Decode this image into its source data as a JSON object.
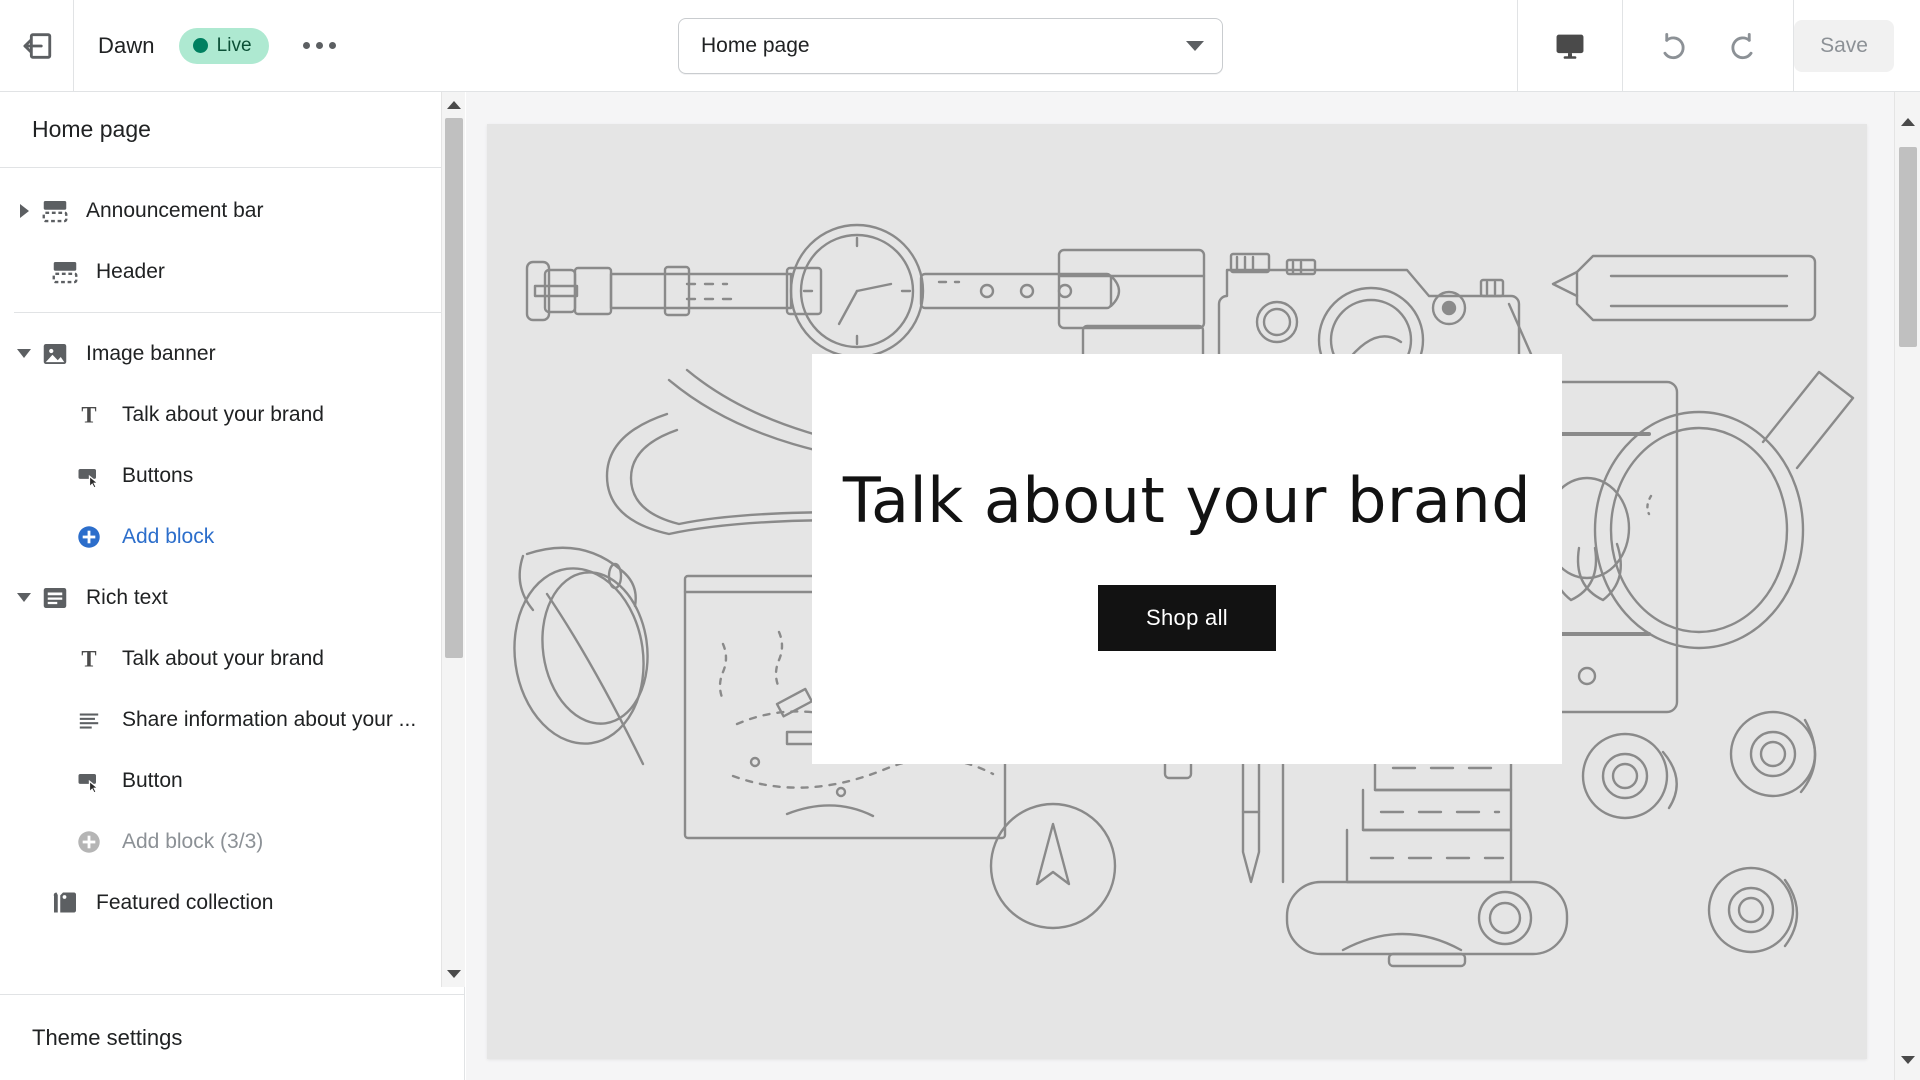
{
  "topbar": {
    "exit_icon": "exit-icon",
    "theme_name": "Dawn",
    "status_badge": "Live",
    "more_menu": "•••",
    "page_selector": {
      "value": "Home page",
      "chevron": "chevron-down-icon"
    },
    "device_icon": "desktop-monitor-icon",
    "undo_icon": "undo-arrow-icon",
    "redo_icon": "redo-arrow-icon",
    "save_label": "Save",
    "save_disabled": true
  },
  "sidebar": {
    "title": "Home page",
    "footer_label": "Theme settings",
    "tree": [
      {
        "label": "Announcement bar",
        "icon": "announcement-bar-icon",
        "disclosure": "collapsed",
        "level": 0
      },
      {
        "label": "Header",
        "icon": "header-section-icon",
        "disclosure": "none",
        "level": 0
      },
      {
        "divider": true
      },
      {
        "label": "Image banner",
        "icon": "image-banner-icon",
        "disclosure": "expanded",
        "level": 0
      },
      {
        "label": "Talk about your brand",
        "icon": "text-block-icon",
        "level": 1
      },
      {
        "label": "Buttons",
        "icon": "button-block-icon",
        "level": 1
      },
      {
        "label": "Add block",
        "icon": "add-circle-icon",
        "level": 1,
        "style": "link"
      },
      {
        "label": "Rich text",
        "icon": "rich-text-icon",
        "disclosure": "expanded",
        "level": 0
      },
      {
        "label": "Talk about your brand",
        "icon": "text-block-icon",
        "level": 1
      },
      {
        "label": "Share information about your ...",
        "icon": "paragraph-block-icon",
        "level": 1
      },
      {
        "label": "Button",
        "icon": "button-block-icon",
        "level": 1
      },
      {
        "label": "Add block (3/3)",
        "icon": "add-circle-icon",
        "level": 1,
        "style": "link-disabled"
      },
      {
        "label": "Featured collection",
        "icon": "collection-tag-icon",
        "disclosure": "none",
        "level": 0
      }
    ]
  },
  "preview": {
    "hero": {
      "heading": "Talk about your brand",
      "button_label": "Shop all"
    },
    "background_illustration": "flat-lay line art: wrist watch, bag strap, sunglasses, map, camera, pencil, book with laurel wreath, magnifying glass, tape reels, camera lens",
    "scrollbar": {
      "up_arrow": "scroll-up-icon",
      "down_arrow": "scroll-down-icon"
    }
  },
  "colors": {
    "accent_link": "#2c6ecb",
    "live_badge_bg": "#aee9d1",
    "live_dot": "#008060",
    "canvas_bg": "#e5e5e5",
    "hero_button_bg": "#121212",
    "border": "#e1e3e5"
  }
}
